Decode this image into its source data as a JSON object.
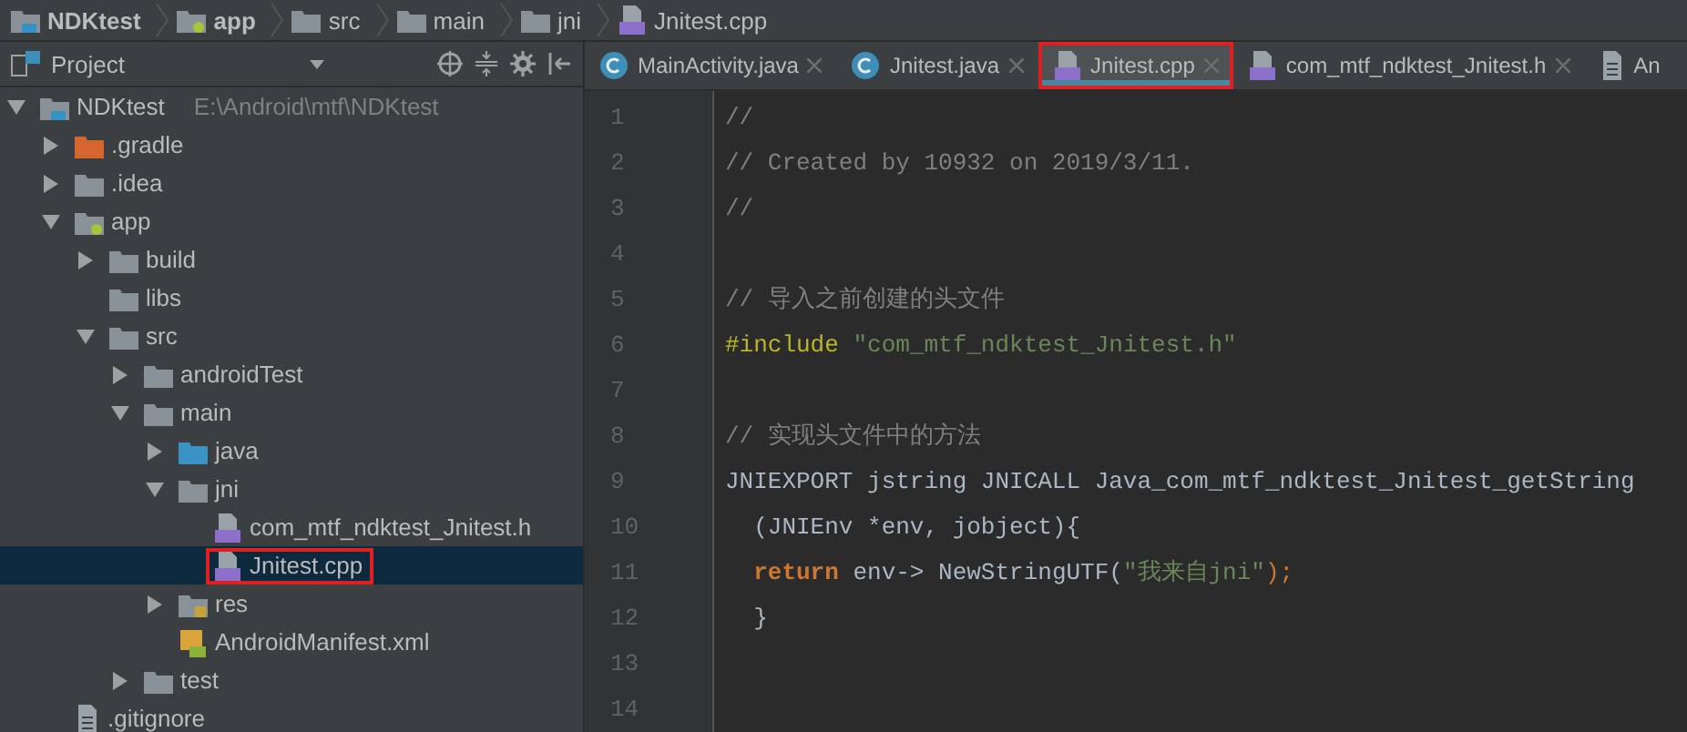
{
  "breadcrumb": [
    {
      "label": "NDKtest",
      "kind": "project",
      "bold": true
    },
    {
      "label": "app",
      "kind": "module",
      "bold": true
    },
    {
      "label": "src",
      "kind": "folder",
      "bold": false
    },
    {
      "label": "main",
      "kind": "folder",
      "bold": false
    },
    {
      "label": "jni",
      "kind": "folder",
      "bold": false
    },
    {
      "label": "Jnitest.cpp",
      "kind": "cpp",
      "bold": false
    }
  ],
  "project_panel": {
    "title": "Project"
  },
  "tree": [
    {
      "label": "NDKtest",
      "path": "E:\\Android\\mtf\\NDKtest",
      "kind": "project",
      "expanded": true,
      "selected": false,
      "highlighted": false,
      "children": [
        {
          "label": ".gradle",
          "kind": "excluded",
          "expanded": false,
          "selected": false,
          "highlighted": false
        },
        {
          "label": ".idea",
          "kind": "folder",
          "expanded": false,
          "selected": false,
          "highlighted": false
        },
        {
          "label": "app",
          "kind": "module",
          "expanded": true,
          "selected": false,
          "highlighted": false,
          "children": [
            {
              "label": "build",
              "kind": "folder",
              "expanded": false,
              "selected": false,
              "highlighted": false
            },
            {
              "label": "libs",
              "kind": "folder",
              "selected": false,
              "highlighted": false
            },
            {
              "label": "src",
              "kind": "folder",
              "expanded": true,
              "selected": false,
              "highlighted": false,
              "children": [
                {
                  "label": "androidTest",
                  "kind": "folder",
                  "expanded": false,
                  "selected": false,
                  "highlighted": false
                },
                {
                  "label": "main",
                  "kind": "folder",
                  "expanded": true,
                  "selected": false,
                  "highlighted": false,
                  "children": [
                    {
                      "label": "java",
                      "kind": "source",
                      "expanded": false,
                      "selected": false,
                      "highlighted": false
                    },
                    {
                      "label": "jni",
                      "kind": "folder",
                      "expanded": true,
                      "selected": false,
                      "highlighted": false,
                      "children": [
                        {
                          "label": "com_mtf_ndktest_Jnitest.h",
                          "kind": "cpp",
                          "selected": false,
                          "highlighted": false
                        },
                        {
                          "label": "Jnitest.cpp",
                          "kind": "cpp",
                          "selected": true,
                          "highlighted": true
                        }
                      ]
                    },
                    {
                      "label": "res",
                      "kind": "resources",
                      "expanded": false,
                      "selected": false,
                      "highlighted": false
                    },
                    {
                      "label": "AndroidManifest.xml",
                      "kind": "manifest",
                      "selected": false,
                      "highlighted": false
                    }
                  ]
                },
                {
                  "label": "test",
                  "kind": "folder",
                  "expanded": false,
                  "selected": false,
                  "highlighted": false
                }
              ]
            }
          ]
        },
        {
          "label": ".gitignore",
          "kind": "text",
          "selected": false,
          "highlighted": false
        }
      ]
    }
  ],
  "tabs": [
    {
      "label": "MainActivity.java",
      "kind": "java",
      "selected": false,
      "highlighted": false,
      "closable": true
    },
    {
      "label": "Jnitest.java",
      "kind": "java",
      "selected": false,
      "highlighted": false,
      "closable": true
    },
    {
      "label": "Jnitest.cpp",
      "kind": "cpp",
      "selected": true,
      "highlighted": true,
      "closable": true
    },
    {
      "label": "com_mtf_ndktest_Jnitest.h",
      "kind": "cpp",
      "selected": false,
      "highlighted": false,
      "closable": true
    },
    {
      "label": "An",
      "kind": "text",
      "selected": false,
      "highlighted": false,
      "closable": false
    }
  ],
  "editor": {
    "lines": [
      {
        "number": "1",
        "segments": [
          {
            "text": "//",
            "kind": "comment"
          }
        ]
      },
      {
        "number": "2",
        "segments": [
          {
            "text": "// Created by 10932 on 2019/3/11.",
            "kind": "comment"
          }
        ]
      },
      {
        "number": "3",
        "segments": [
          {
            "text": "//",
            "kind": "comment"
          }
        ]
      },
      {
        "number": "4"
      },
      {
        "number": "5",
        "segments": [
          {
            "text": "// 导入之前创建的头文件",
            "kind": "comment"
          }
        ]
      },
      {
        "number": "6",
        "segments": [
          {
            "text": "#include",
            "kind": "macro"
          },
          {
            "text": " \"com_mtf_ndktest_Jnitest.h\"",
            "kind": "string"
          }
        ]
      },
      {
        "number": "7"
      },
      {
        "number": "8",
        "segments": [
          {
            "text": "// 实现头文件中的方法",
            "kind": "comment"
          }
        ]
      },
      {
        "number": "9",
        "segments": [
          {
            "text": "JNIEXPORT jstring JNICALL Java_com_mtf_ndktest_Jnitest_getString",
            "kind": "plain"
          }
        ]
      },
      {
        "number": "10",
        "segments": [
          {
            "text": "  (JNIEnv *env, jobject){",
            "kind": "plain"
          }
        ]
      },
      {
        "number": "11",
        "segments": [
          {
            "text": "  return",
            "kind": "keyword"
          },
          {
            "text": " env-> NewStringUTF(",
            "kind": "plain"
          },
          {
            "text": "\"我来自jni\"",
            "kind": "string"
          },
          {
            "text": ");",
            "kind": "punct"
          }
        ]
      },
      {
        "number": "12",
        "segments": [
          {
            "text": "  }",
            "kind": "plain"
          }
        ]
      },
      {
        "number": "13"
      },
      {
        "number": "14"
      }
    ]
  }
}
